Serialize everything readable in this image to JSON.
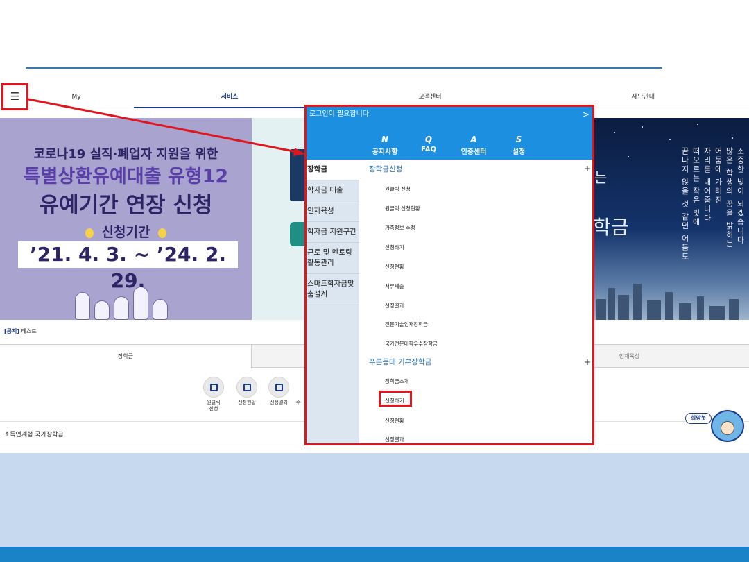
{
  "nav": {
    "hamburger_icon": "☰",
    "items": [
      "My",
      "서비스",
      "고객센터",
      "재단안내"
    ],
    "active": "서비스"
  },
  "banner_left": {
    "line1": "코로나19 실직·폐업자 지원을 위한",
    "line2": "특별상환유예대출 유형12",
    "line3": "유예기간 연장 신청",
    "period_label": "신청기간",
    "dates": "’21. 4. 3. ~ ’24. 2. 29."
  },
  "banner_right": {
    "text_small": "는",
    "text_big": "학금",
    "poem": [
      "소중한 빛이 되겠습니다",
      "많은 학생의 꿈을 밝히는",
      "어둠에 가려진",
      "자리를 내어줍니다",
      "떠오르는 작은 빛에",
      "끝나지 않을 것 같던 어둠도"
    ]
  },
  "notice": {
    "tag": "[공지]",
    "text": "테스트"
  },
  "tabs": {
    "left": "장학금",
    "right": "인재육성"
  },
  "services": [
    {
      "label": "원클릭\n신청",
      "icon": "cursor-click-icon"
    },
    {
      "label": "신청현황",
      "icon": "presentation-icon"
    },
    {
      "label": "선정결과",
      "icon": "search-doc-icon"
    },
    {
      "label": "수",
      "icon": "doc-icon"
    }
  ],
  "income_title": "소득연계형 국가장학금",
  "chatbot": {
    "badge": "희망봇"
  },
  "menu": {
    "login_text": "로그인이 필요합니다.",
    "login_chevron": ">",
    "quick": [
      {
        "icon": "N",
        "label": "공지사항"
      },
      {
        "icon": "Q",
        "label": "FAQ"
      },
      {
        "icon": "A",
        "label": "인증센터"
      },
      {
        "icon": "S",
        "label": "설정"
      }
    ],
    "side": [
      "장학금",
      "학자금 대출",
      "인재육성",
      "학자금 지원구간",
      "근로 및 멘토링 활동관리",
      "스마트학자금맞춤설계"
    ],
    "section1": {
      "title": "장학금신청",
      "plus": "+",
      "items": [
        "원클릭 신청",
        "원클릭 신청현황",
        "가족정보 수정",
        "신청하기",
        "신청현황",
        "서류제출",
        "선정결과",
        "전문기술인재장학금",
        "국가전문대학우수장학금"
      ]
    },
    "section2": {
      "title": "푸른등대 기부장학금",
      "plus": "+",
      "items": [
        "장학금소개",
        "신청하기",
        "신청현황",
        "선정결과"
      ]
    }
  },
  "colors": {
    "primary": "#1d8fe0",
    "highlight": "#e0161f",
    "navy": "#1a3a8b"
  }
}
